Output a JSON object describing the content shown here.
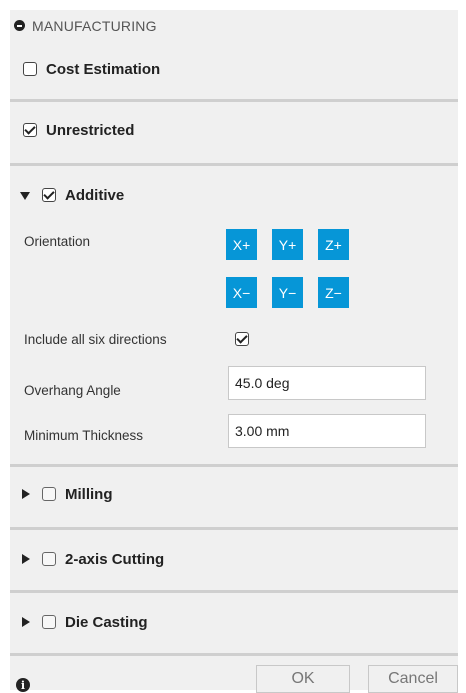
{
  "header": {
    "title": "MANUFACTURING"
  },
  "sections": {
    "cost_estimation": {
      "label": "Cost Estimation",
      "checked": false
    },
    "unrestricted": {
      "label": "Unrestricted",
      "checked": true
    },
    "additive": {
      "label": "Additive",
      "checked": true,
      "expanded": true
    },
    "milling": {
      "label": "Milling",
      "checked": false,
      "expanded": false
    },
    "two_axis": {
      "label": "2-axis Cutting",
      "checked": false,
      "expanded": false
    },
    "die_casting": {
      "label": "Die Casting",
      "checked": false,
      "expanded": false
    }
  },
  "additive": {
    "orientation_label": "Orientation",
    "directions": [
      "X+",
      "Y+",
      "Z+",
      "X−",
      "Y−",
      "Z−"
    ],
    "six_dir_label": "Include all six directions",
    "six_dir_checked": true,
    "overhang_label": "Overhang Angle",
    "overhang_value": "45.0 deg",
    "thickness_label": "Minimum Thickness",
    "thickness_value": "3.00 mm"
  },
  "footer": {
    "ok_label": "OK",
    "cancel_label": "Cancel"
  },
  "colors": {
    "accent": "#0696d7",
    "panel_bg": "#f0f0f0"
  },
  "icons": {
    "collapse": "minus-circle-icon",
    "info": "info-icon"
  }
}
